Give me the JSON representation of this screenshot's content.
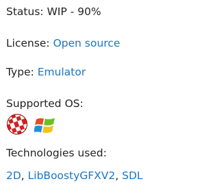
{
  "status": {
    "label": "Status:",
    "value": "WIP - 90%"
  },
  "license": {
    "label": "License:",
    "value": "Open source"
  },
  "type": {
    "label": "Type:",
    "value": "Emulator"
  },
  "supported_os": {
    "label": "Supported OS:",
    "icons": [
      "amiga-boing-ball-icon",
      "windows-logo-icon"
    ]
  },
  "technologies": {
    "label": "Technologies used:",
    "items": [
      "2D",
      "LibBoostyGFXV2",
      "SDL"
    ],
    "separator": ", "
  },
  "colors": {
    "text": "#222222",
    "link": "#1a75c2",
    "amiga_red": "#d42020",
    "amiga_white": "#ffffff"
  }
}
